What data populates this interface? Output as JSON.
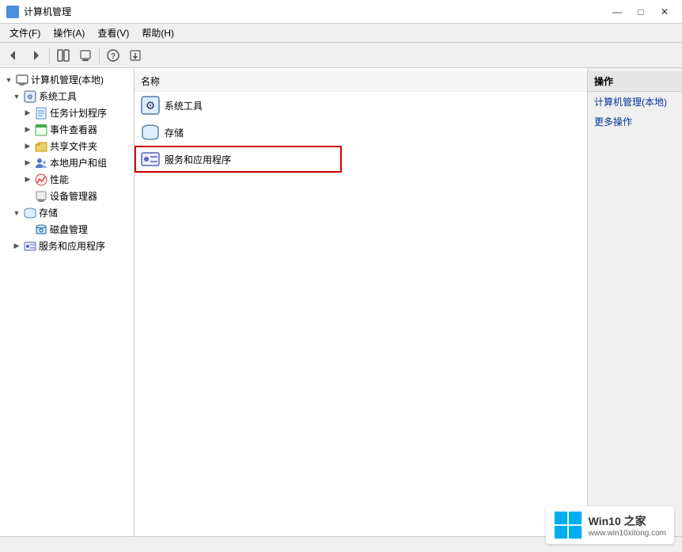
{
  "window": {
    "title": "计算机管理",
    "title_icon": "computer-management-icon"
  },
  "menubar": {
    "items": [
      {
        "id": "file",
        "label": "文件(F)"
      },
      {
        "id": "action",
        "label": "操作(A)"
      },
      {
        "id": "view",
        "label": "查看(V)"
      },
      {
        "id": "help",
        "label": "帮助(H)"
      }
    ]
  },
  "toolbar": {
    "buttons": [
      {
        "id": "back",
        "icon": "◀",
        "label": "后退"
      },
      {
        "id": "forward",
        "icon": "▶",
        "label": "前进"
      },
      {
        "id": "up",
        "icon": "▲",
        "label": "向上"
      },
      {
        "id": "show-hide",
        "icon": "🗂",
        "label": "显示/隐藏"
      },
      {
        "id": "help",
        "icon": "?",
        "label": "帮助"
      },
      {
        "id": "export",
        "icon": "📤",
        "label": "导出"
      }
    ]
  },
  "tree": {
    "root": {
      "label": "计算机管理(本地)",
      "icon": "computer-icon",
      "expanded": true,
      "children": [
        {
          "label": "系统工具",
          "icon": "tools-icon",
          "expanded": true,
          "indent": 1,
          "children": [
            {
              "label": "任务计划程序",
              "icon": "task-icon",
              "indent": 2
            },
            {
              "label": "事件查看器",
              "icon": "event-icon",
              "indent": 2
            },
            {
              "label": "共享文件夹",
              "icon": "share-icon",
              "indent": 2
            },
            {
              "label": "本地用户和组",
              "icon": "user-icon",
              "indent": 2
            },
            {
              "label": "性能",
              "icon": "perf-icon",
              "indent": 2
            },
            {
              "label": "设备管理器",
              "icon": "device-icon",
              "indent": 2
            }
          ]
        },
        {
          "label": "存储",
          "icon": "storage-icon",
          "expanded": true,
          "indent": 1,
          "children": [
            {
              "label": "磁盘管理",
              "icon": "disk-icon",
              "indent": 2
            }
          ]
        },
        {
          "label": "服务和应用程序",
          "icon": "service-icon",
          "indent": 1
        }
      ]
    }
  },
  "center": {
    "header": "名称",
    "items": [
      {
        "id": "system-tools",
        "label": "系统工具",
        "icon": "tools-icon"
      },
      {
        "id": "storage",
        "label": "存储",
        "icon": "storage-icon"
      },
      {
        "id": "services-apps",
        "label": "服务和应用程序",
        "icon": "service-icon",
        "highlighted": true
      }
    ]
  },
  "right_panel": {
    "header": "操作",
    "items": [
      {
        "id": "computer-mgmt",
        "label": "计算机管理(本地)"
      },
      {
        "id": "more-ops",
        "label": "更多操作"
      }
    ]
  },
  "statusbar": {
    "text": ""
  },
  "watermark": {
    "title": "Win10 之家",
    "subtitle": "www.win10xitong.com"
  }
}
